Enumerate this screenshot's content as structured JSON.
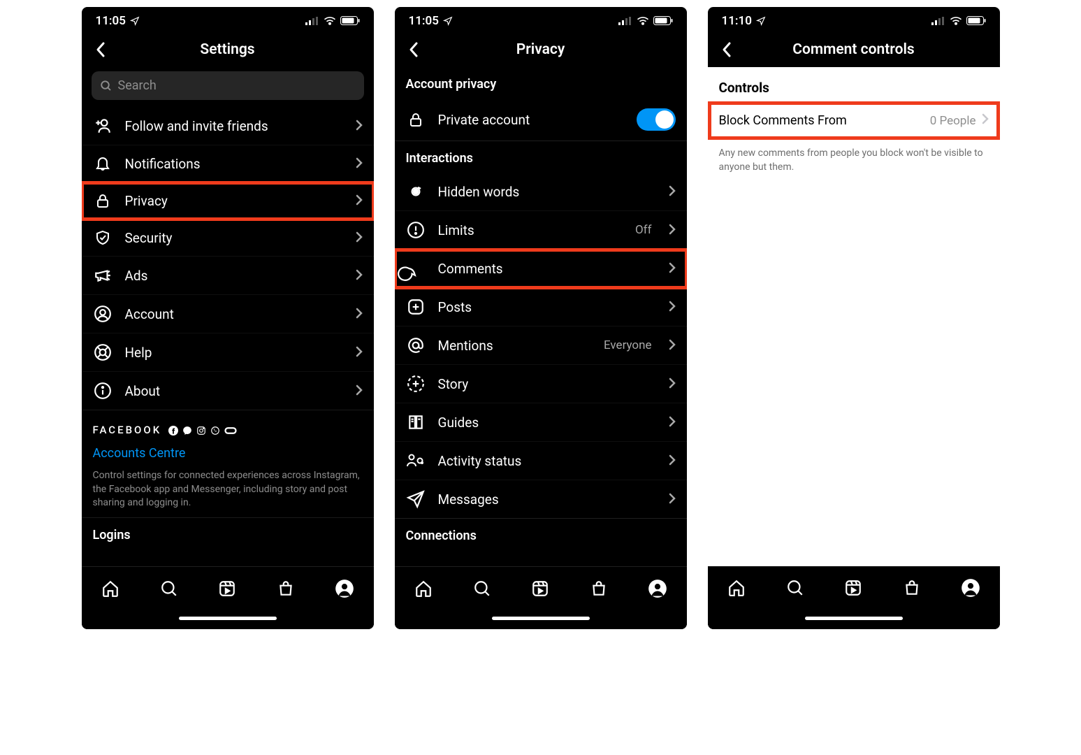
{
  "screen1": {
    "time": "11:05",
    "title": "Settings",
    "search_placeholder": "Search",
    "rows": {
      "follow": "Follow and invite friends",
      "notifications": "Notifications",
      "privacy": "Privacy",
      "security": "Security",
      "ads": "Ads",
      "account": "Account",
      "help": "Help",
      "about": "About"
    },
    "brand": "FACEBOOK",
    "accounts_centre": "Accounts Centre",
    "accounts_desc": "Control settings for connected experiences across Instagram, the Facebook app and Messenger, including story and post sharing and logging in.",
    "logins_header": "Logins"
  },
  "screen2": {
    "time": "11:05",
    "title": "Privacy",
    "section_account": "Account privacy",
    "private_account": "Private account",
    "section_interactions": "Interactions",
    "rows": {
      "hidden_words": "Hidden words",
      "limits": "Limits",
      "limits_detail": "Off",
      "comments": "Comments",
      "posts": "Posts",
      "mentions": "Mentions",
      "mentions_detail": "Everyone",
      "story": "Story",
      "guides": "Guides",
      "activity_status": "Activity status",
      "messages": "Messages"
    },
    "section_connections": "Connections"
  },
  "screen3": {
    "time": "11:10",
    "title": "Comment controls",
    "section_controls": "Controls",
    "block_comments": "Block Comments From",
    "block_detail": "0 People",
    "help": "Any new comments from people you block won't be visible to anyone but them."
  }
}
